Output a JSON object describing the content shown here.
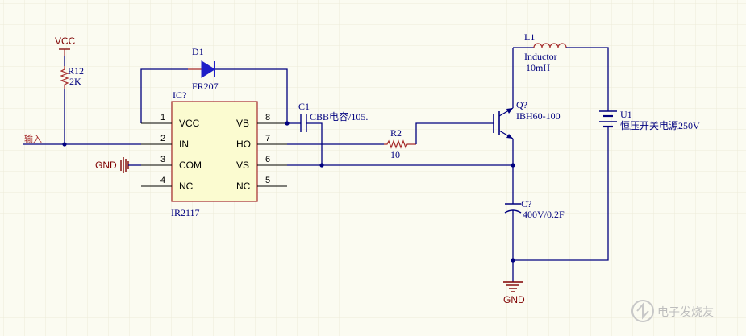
{
  "power": {
    "vcc_label": "VCC",
    "gnd_left_label": "GND",
    "gnd_bottom_label": "GND"
  },
  "net": {
    "input_label": "输入"
  },
  "components": {
    "r12": {
      "designator": "R12",
      "value": "2K"
    },
    "d1": {
      "designator": "D1",
      "value": "FR207"
    },
    "ic": {
      "designator": "IC?",
      "part": "IR2117",
      "pins_left": [
        {
          "num": "1",
          "name": "VCC"
        },
        {
          "num": "2",
          "name": "IN"
        },
        {
          "num": "3",
          "name": "COM"
        },
        {
          "num": "4",
          "name": "NC"
        }
      ],
      "pins_right": [
        {
          "num": "8",
          "name": "VB"
        },
        {
          "num": "7",
          "name": "HO"
        },
        {
          "num": "6",
          "name": "VS"
        },
        {
          "num": "5",
          "name": "NC"
        }
      ]
    },
    "c1": {
      "designator": "C1",
      "value": "CBB电容/105."
    },
    "r2": {
      "designator": "R2",
      "value": "10"
    },
    "q": {
      "designator": "Q?",
      "value": "IBH60-100"
    },
    "l1": {
      "designator": "L1",
      "part": "Inductor",
      "value": "10mH"
    },
    "u1": {
      "designator": "U1",
      "value": "恒压开关电源250V"
    },
    "c_bottom": {
      "designator": "C?",
      "value": "400V/0.2F"
    }
  },
  "watermark": {
    "text": "电子发烧友"
  },
  "colors": {
    "background": "#fbfbf1",
    "wire": "#00007f",
    "component_outline": "#a52a2a",
    "ic_fill": "#fbfbd0",
    "power_label": "#7f0000",
    "diode_fill": "#1e1ec8"
  }
}
